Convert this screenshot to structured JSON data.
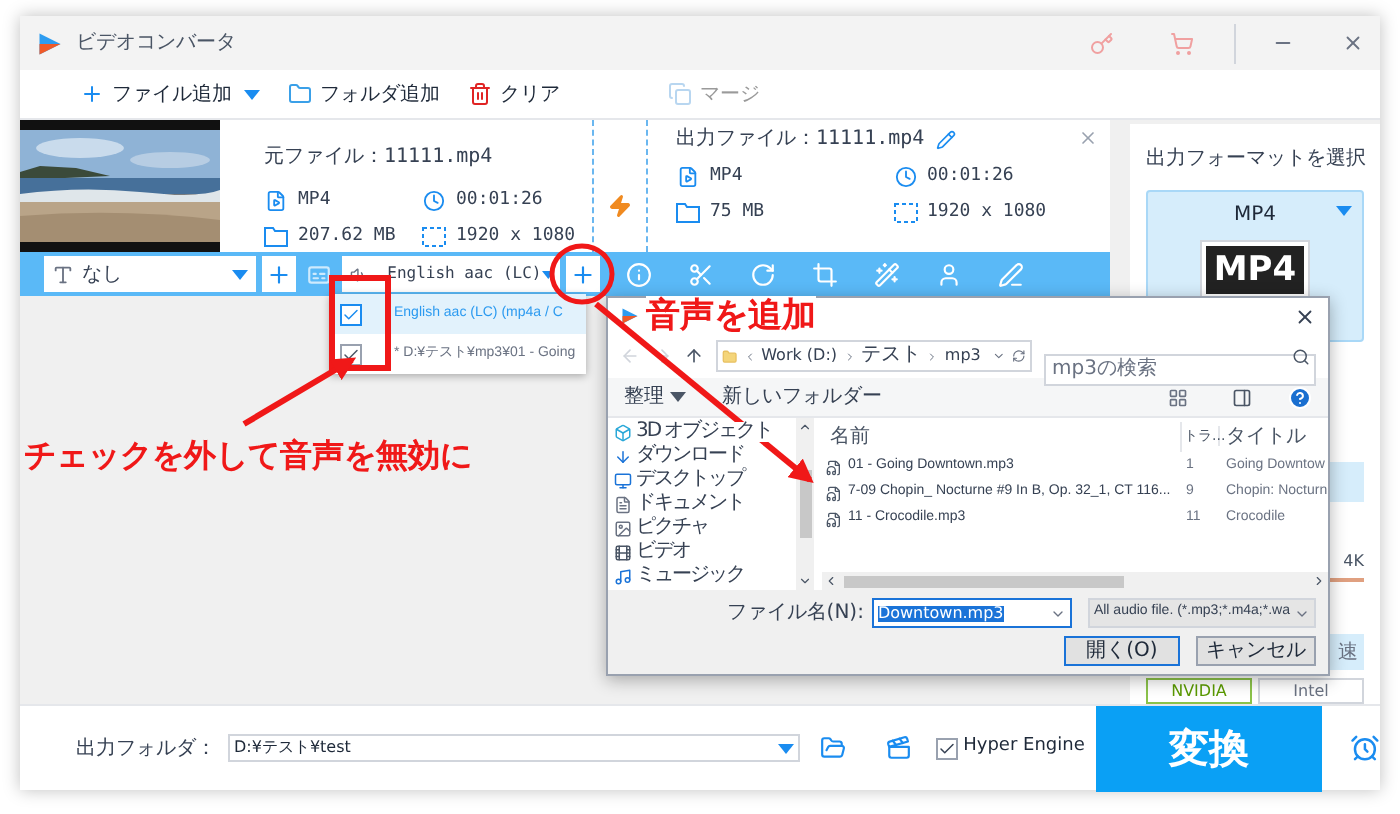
{
  "window": {
    "title": "ビデオコンバータ"
  },
  "toolbar": [
    {
      "label": "ファイル追加",
      "kind": "add",
      "disabled": false
    },
    {
      "label": "フォルダ追加",
      "kind": "folder",
      "disabled": false
    },
    {
      "label": "クリア",
      "kind": "clear",
      "disabled": false
    },
    {
      "label": "マージ",
      "kind": "merge",
      "disabled": true
    }
  ],
  "file": {
    "source_label": "元ファイル：",
    "source_name": "11111.mp4",
    "source": {
      "format": "MP4",
      "duration": "00:01:26",
      "size": "207.62 MB",
      "resolution": "1920 x 1080"
    },
    "output_label": "出力ファイル：",
    "output_name": "11111.mp4",
    "output": {
      "format": "MP4",
      "duration": "00:01:26",
      "size": "75 MB",
      "resolution": "1920 x 1080"
    }
  },
  "edit_bar": {
    "subtitle": "なし",
    "audio": "English aac (LC)"
  },
  "audio_tracks": [
    {
      "label": "English aac (LC) (mp4a / C",
      "checked": true,
      "selected": true
    },
    {
      "label": "* D:¥テスト¥mp3¥01 - Going",
      "checked": true,
      "selected": false
    }
  ],
  "format_panel": {
    "heading": "出力フォーマットを選択",
    "format": "MP4",
    "badge": "MP4",
    "resolution_mark": "4K",
    "accel": "速",
    "gpu": [
      "NVIDIA",
      "Intel"
    ]
  },
  "dialog": {
    "address": [
      "Work (D:)",
      "テスト",
      "mp3"
    ],
    "search_placeholder": "mp3の検索",
    "organize": "整理",
    "new_folder": "新しいフォルダー",
    "nav": [
      {
        "label": "3D オブジェクト",
        "kind": "objects"
      },
      {
        "label": "ダウンロード",
        "kind": "download"
      },
      {
        "label": "デスクトップ",
        "kind": "desktop"
      },
      {
        "label": "ドキュメント",
        "kind": "documents"
      },
      {
        "label": "ピクチャ",
        "kind": "pictures"
      },
      {
        "label": "ビデオ",
        "kind": "videos"
      },
      {
        "label": "ミュージック",
        "kind": "music"
      }
    ],
    "columns": [
      "名前",
      "トラ...",
      "タイトル"
    ],
    "rows": [
      {
        "name": "01 - Going Downtown.mp3",
        "track": "1",
        "title": "Going Downtow"
      },
      {
        "name": "7-09 Chopin_ Nocturne #9 In B, Op. 32_1, CT 116...",
        "track": "9",
        "title": "Chopin: Nocturn"
      },
      {
        "name": "11 - Crocodile.mp3",
        "track": "11",
        "title": "Crocodile"
      }
    ],
    "filename_label": "ファイル名(N):",
    "filename": "Downtown.mp3",
    "filter": "All audio file. (*.mp3;*.m4a;*.wa",
    "open": "開く(O)",
    "cancel": "キャンセル"
  },
  "bottom": {
    "folder_label": "出力フォルダ：",
    "folder": "D:¥テスト¥test",
    "hyper_engine": {
      "label": "Hyper Engine",
      "checked": true
    },
    "convert": "変換"
  },
  "annotations": [
    {
      "text": "チェックを外して音声を無効に"
    },
    {
      "text": "音声を追加"
    }
  ]
}
